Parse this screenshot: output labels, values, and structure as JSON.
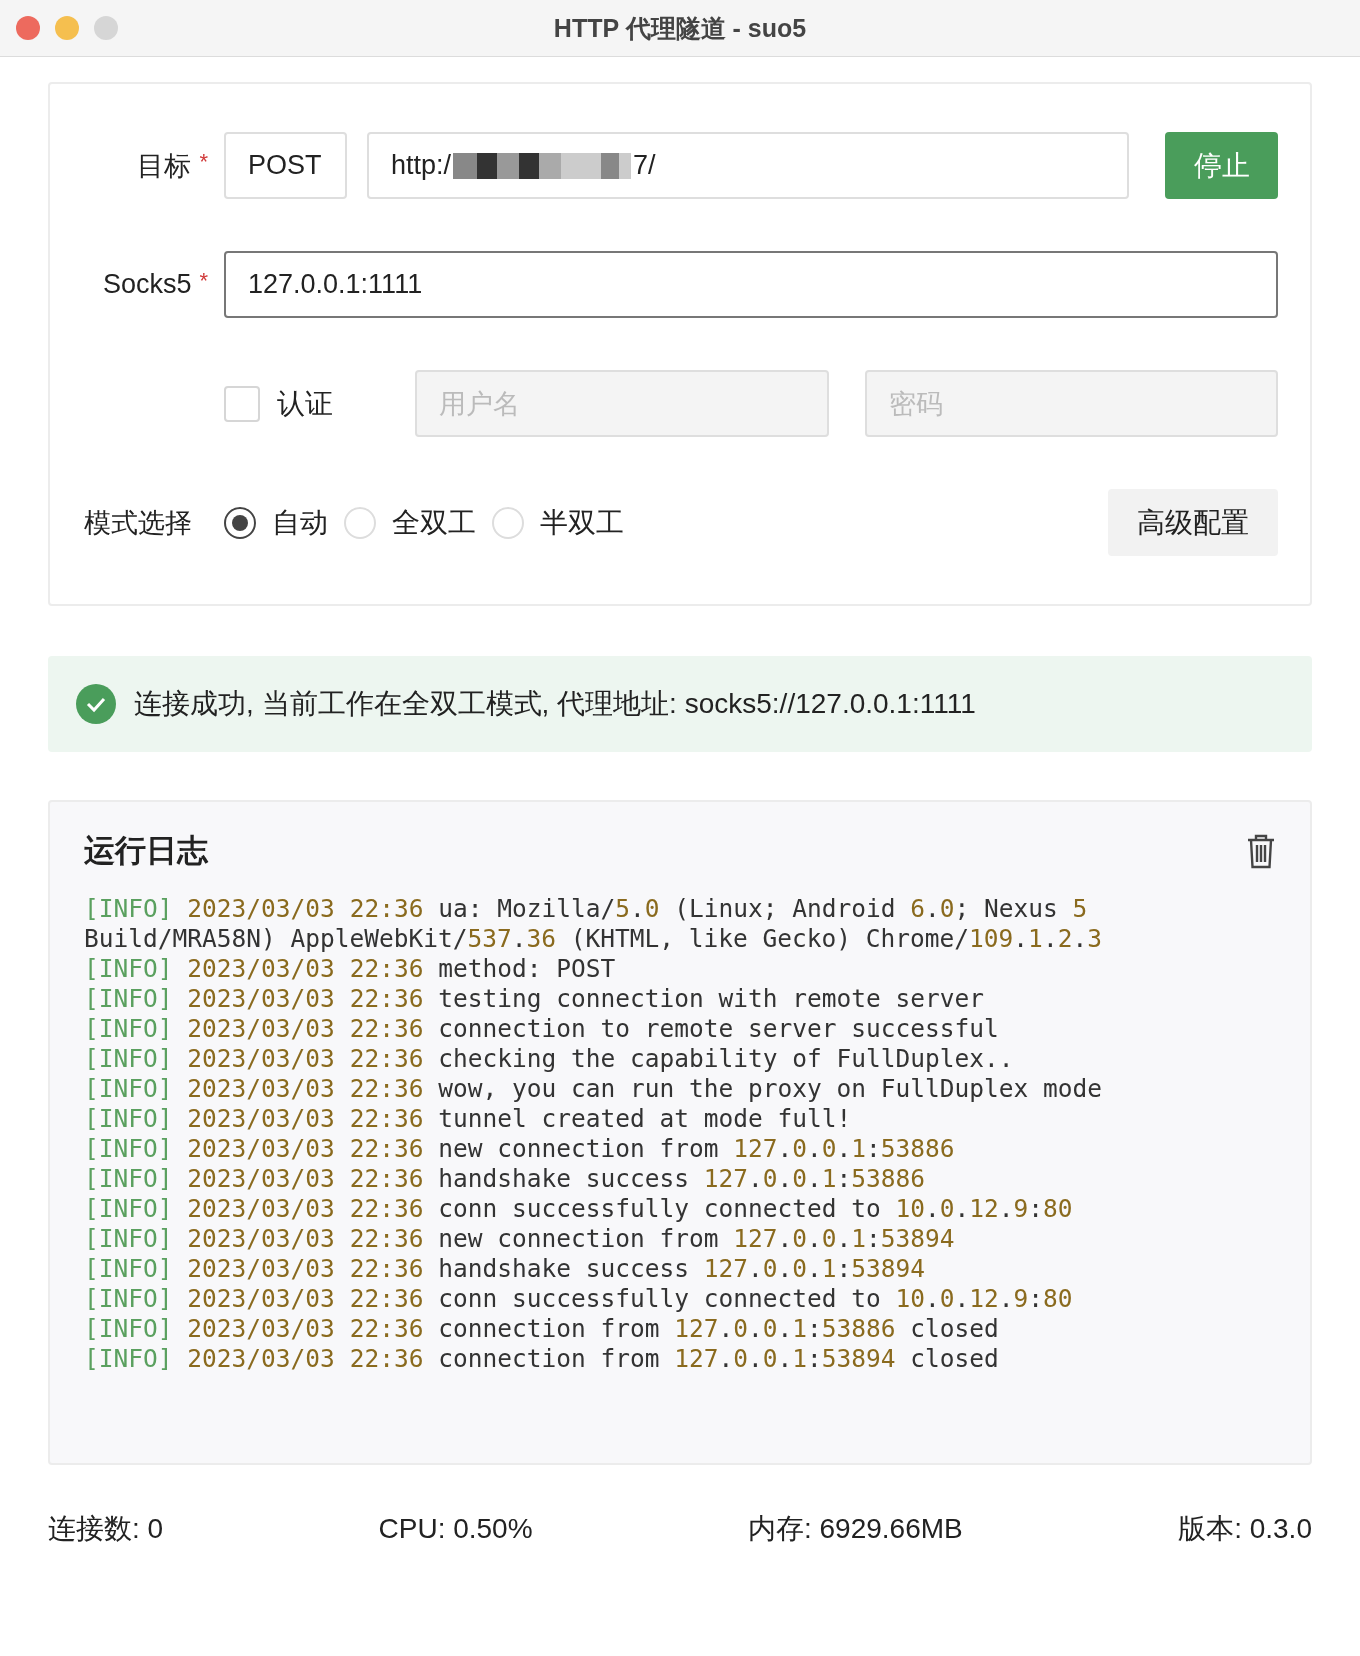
{
  "window": {
    "title": "HTTP 代理隧道 - suo5"
  },
  "form": {
    "target_label": "目标",
    "required_mark": "*",
    "method": "POST",
    "url_prefix": "http:/",
    "url_suffix": "7/",
    "stop_button": "停止",
    "socks_label": "Socks5",
    "socks_value": "127.0.0.1:1111",
    "auth": {
      "label": "认证",
      "checked": false,
      "username_placeholder": "用户名",
      "password_placeholder": "密码"
    },
    "mode_label": "模式选择",
    "modes": [
      {
        "label": "自动",
        "selected": true
      },
      {
        "label": "全双工",
        "selected": false
      },
      {
        "label": "半双工",
        "selected": false
      }
    ],
    "advanced_button": "高级配置"
  },
  "alert": {
    "kind": "success",
    "text": "连接成功, 当前工作在全双工模式, 代理地址: socks5://127.0.0.1:1111"
  },
  "log": {
    "title": "运行日志",
    "lines": [
      {
        "level": "[INFO]",
        "time": "2023/03/03 22:36",
        "message": "ua: Mozilla/5.0 (Linux; Android 6.0; Nexus 5 Build/MRA58N) AppleWebKit/537.36 (KHTML, like Gecko) Chrome/109.1.2.3"
      },
      {
        "level": "[INFO]",
        "time": "2023/03/03 22:36",
        "message": "method: POST"
      },
      {
        "level": "[INFO]",
        "time": "2023/03/03 22:36",
        "message": "testing connection with remote server"
      },
      {
        "level": "[INFO]",
        "time": "2023/03/03 22:36",
        "message": "connection to remote server successful"
      },
      {
        "level": "[INFO]",
        "time": "2023/03/03 22:36",
        "message": "checking the capability of FullDuplex.."
      },
      {
        "level": "[INFO]",
        "time": "2023/03/03 22:36",
        "message": "wow, you can run the proxy on FullDuplex mode"
      },
      {
        "level": "[INFO]",
        "time": "2023/03/03 22:36",
        "message": "tunnel created at mode full!"
      },
      {
        "level": "[INFO]",
        "time": "2023/03/03 22:36",
        "message": "new connection from 127.0.0.1:53886"
      },
      {
        "level": "[INFO]",
        "time": "2023/03/03 22:36",
        "message": "handshake success 127.0.0.1:53886"
      },
      {
        "level": "[INFO]",
        "time": "2023/03/03 22:36",
        "message": "conn successfully connected to 10.0.12.9:80"
      },
      {
        "level": "[INFO]",
        "time": "2023/03/03 22:36",
        "message": "new connection from 127.0.0.1:53894"
      },
      {
        "level": "[INFO]",
        "time": "2023/03/03 22:36",
        "message": "handshake success 127.0.0.1:53894"
      },
      {
        "level": "[INFO]",
        "time": "2023/03/03 22:36",
        "message": "conn successfully connected to 10.0.12.9:80"
      },
      {
        "level": "[INFO]",
        "time": "2023/03/03 22:36",
        "message": "connection from 127.0.0.1:53886 closed"
      },
      {
        "level": "[INFO]",
        "time": "2023/03/03 22:36",
        "message": "connection from 127.0.0.1:53894 closed"
      }
    ]
  },
  "status_bar": [
    "连接数: 0",
    "CPU: 0.50%",
    "内存: 6929.66MB",
    "版本: 0.3.0"
  ]
}
